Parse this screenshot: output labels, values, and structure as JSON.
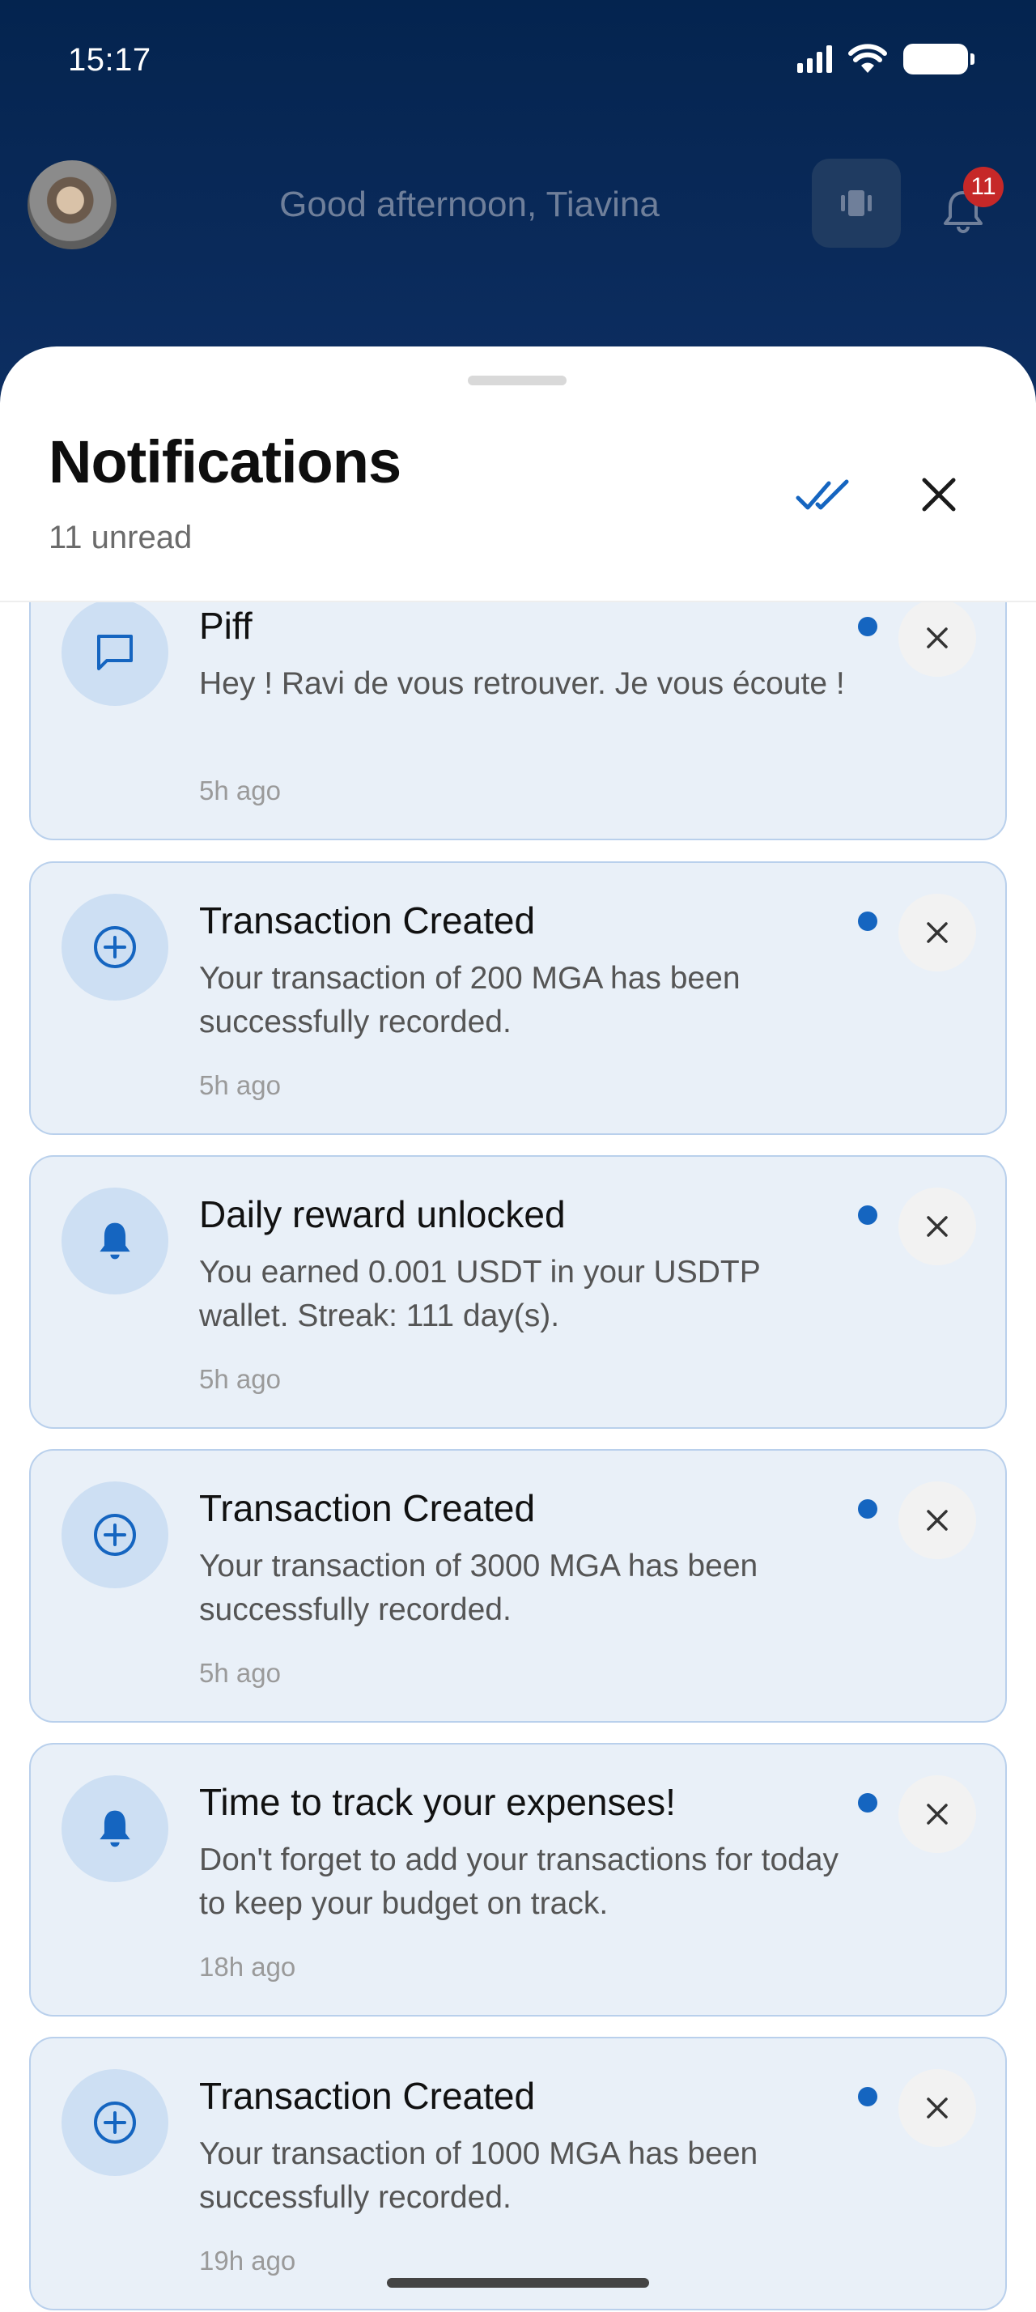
{
  "status_bar": {
    "time": "15:17"
  },
  "header": {
    "greeting": "Good afternoon, Tiavina",
    "notification_count": "11"
  },
  "sheet": {
    "title": "Notifications",
    "subtitle": "11 unread"
  },
  "notifications": [
    {
      "icon": "chat-icon",
      "title": "Piff",
      "message": "Hey ! Ravi de vous retrouver. Je vous écoute !",
      "time": "5h ago",
      "unread": true
    },
    {
      "icon": "plus-circle-icon",
      "title": "Transaction Created",
      "message": "Your transaction of 200 MGA has been successfully recorded.",
      "time": "5h ago",
      "unread": true
    },
    {
      "icon": "bell-icon",
      "title": "Daily reward unlocked",
      "message": "You earned 0.001 USDT in your USDTP wallet. Streak: 111 day(s).",
      "time": "5h ago",
      "unread": true
    },
    {
      "icon": "plus-circle-icon",
      "title": "Transaction Created",
      "message": "Your transaction of 3000 MGA has been successfully recorded.",
      "time": "5h ago",
      "unread": true
    },
    {
      "icon": "bell-icon",
      "title": "Time to track your expenses!",
      "message": "Don't forget to add your transactions for today to keep your budget on track.",
      "time": "18h ago",
      "unread": true
    },
    {
      "icon": "plus-circle-icon",
      "title": "Transaction Created",
      "message": "Your transaction of 1000 MGA has been successfully recorded.",
      "time": "19h ago",
      "unread": true
    }
  ],
  "colors": {
    "accent": "#1565c0",
    "card_bg": "#e9f0f8",
    "card_border": "#b9d0ec",
    "header_bg": "#04244f",
    "badge": "#c62828"
  }
}
